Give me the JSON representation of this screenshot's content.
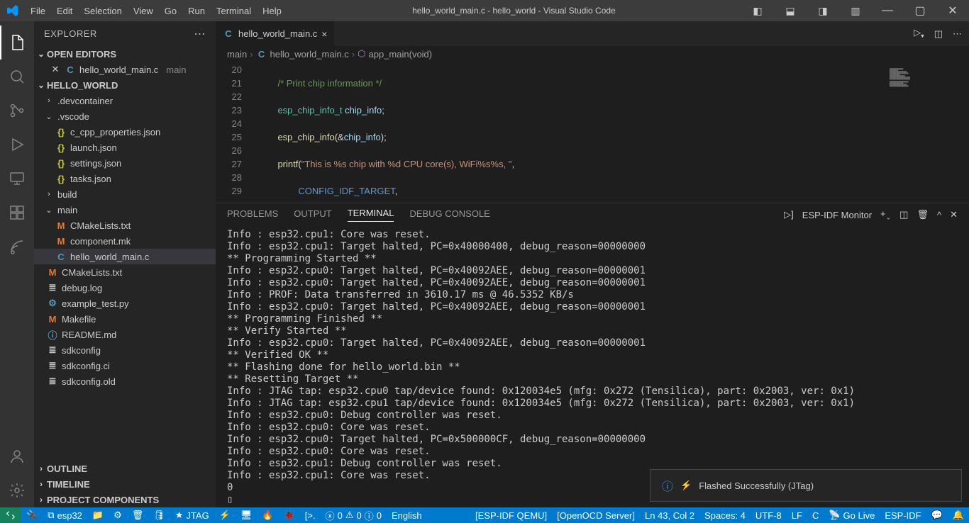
{
  "title": "hello_world_main.c - hello_world - Visual Studio Code",
  "menu": [
    "File",
    "Edit",
    "Selection",
    "View",
    "Go",
    "Run",
    "Terminal",
    "Help"
  ],
  "explorer": {
    "title": "EXPLORER",
    "sections": {
      "openEditors": "OPEN EDITORS",
      "project": "HELLO_WORLD",
      "outline": "OUTLINE",
      "timeline": "TIMELINE",
      "projectComponents": "PROJECT COMPONENTS"
    },
    "openFile": {
      "name": "hello_world_main.c",
      "folder": "main"
    },
    "tree": {
      "devcontainer": ".devcontainer",
      "vscode": ".vscode",
      "vsfiles": [
        "c_cpp_properties.json",
        "launch.json",
        "settings.json",
        "tasks.json"
      ],
      "build": "build",
      "mainDir": "main",
      "mainFiles": {
        "cmake": "CMakeLists.txt",
        "componentmk": "component.mk",
        "helloworld": "hello_world_main.c"
      },
      "rootFiles": {
        "cmake": "CMakeLists.txt",
        "debug": "debug.log",
        "example": "example_test.py",
        "makefile": "Makefile",
        "readme": "README.md",
        "sdkconfig": "sdkconfig",
        "sdkconfigci": "sdkconfig.ci",
        "sdkconfigold": "sdkconfig.old"
      }
    }
  },
  "tab": {
    "name": "hello_world_main.c"
  },
  "breadcrumb": {
    "p1": "main",
    "p2": "hello_world_main.c",
    "p3": "app_main(void)"
  },
  "lines": [
    "20",
    "21",
    "22",
    "23",
    "24",
    "25",
    "26",
    "27",
    "28",
    "29"
  ],
  "panel": {
    "tabs": {
      "problems": "PROBLEMS",
      "output": "OUTPUT",
      "terminal": "TERMINAL",
      "debug": "DEBUG CONSOLE"
    },
    "monitor": "ESP-IDF Monitor"
  },
  "terminal": "Info : esp32.cpu1: Core was reset.\nInfo : esp32.cpu1: Target halted, PC=0x40000400, debug_reason=00000000\n** Programming Started **\nInfo : esp32.cpu0: Target halted, PC=0x40092AEE, debug_reason=00000001\nInfo : esp32.cpu0: Target halted, PC=0x40092AEE, debug_reason=00000001\nInfo : PROF: Data transferred in 3610.17 ms @ 46.5352 KB/s\nInfo : esp32.cpu0: Target halted, PC=0x40092AEE, debug_reason=00000001\n** Programming Finished **\n** Verify Started **\nInfo : esp32.cpu0: Target halted, PC=0x40092AEE, debug_reason=00000001\n** Verified OK **\n** Flashing done for hello_world.bin **\n** Resetting Target **\nInfo : JTAG tap: esp32.cpu0 tap/device found: 0x120034e5 (mfg: 0x272 (Tensilica), part: 0x2003, ver: 0x1)\nInfo : JTAG tap: esp32.cpu1 tap/device found: 0x120034e5 (mfg: 0x272 (Tensilica), part: 0x2003, ver: 0x1)\nInfo : esp32.cpu0: Debug controller was reset.\nInfo : esp32.cpu0: Core was reset.\nInfo : esp32.cpu0: Target halted, PC=0x500000CF, debug_reason=00000000\nInfo : esp32.cpu0: Core was reset.\nInfo : esp32.cpu1: Debug controller was reset.\nInfo : esp32.cpu1: Core was reset.\n0\n▯",
  "notification": "Flashed Successfully (JTag)",
  "status": {
    "target": "esp32",
    "jtag": "JTAG",
    "errs": "0",
    "warns": "0",
    "info": "0",
    "lang": "English",
    "qemu": "[ESP-IDF QEMU]",
    "openocd": "[OpenOCD Server]",
    "lncol": "Ln 43, Col 2",
    "spaces": "Spaces: 4",
    "enc": "UTF-8",
    "eol": "LF",
    "ftype": "C",
    "golive": "Go Live",
    "espidf": "ESP-IDF"
  }
}
